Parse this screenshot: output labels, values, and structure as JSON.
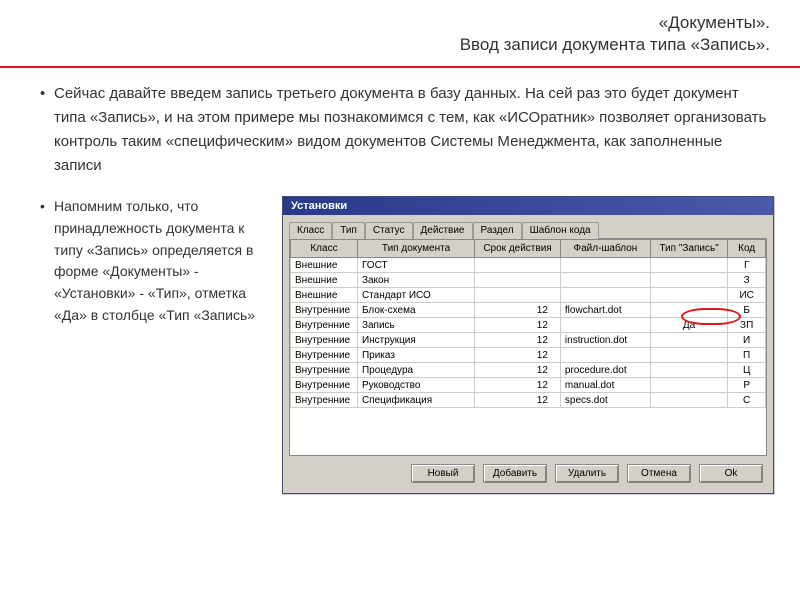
{
  "header": {
    "line1": "«Документы».",
    "line2": "Ввод записи документа типа «Запись»."
  },
  "main_bullet": "Сейчас давайте введем запись третьего документа в базу данных. На сей раз это будет документ типа «Запись», и на этом примере мы познакомимся с тем, как «ИСОратник» позволяет организовать контроль таким «специфическим» видом документов Системы Менеджмента, как заполненные записи",
  "side_bullet": "Напомним только, что принадлежность документа к типу «Запись» определяется в форме «Документы» - «Установки» - «Тип», отметка «Да» в столбце «Тип «Запись»",
  "dialog": {
    "title": "Установки",
    "tabs": [
      "Класс",
      "Тип",
      "Статус",
      "Действие",
      "Раздел",
      "Шаблон кода"
    ],
    "active_tab_index": 1,
    "columns": [
      "Класс",
      "Тип документа",
      "Срок действия",
      "Файл-шаблон",
      "Тип \"Запись\"",
      "Код"
    ],
    "rows": [
      {
        "class": "Внешние",
        "type": "ГОСТ",
        "term": "",
        "file": "",
        "zapis": "",
        "code": "Г"
      },
      {
        "class": "Внешние",
        "type": "Закон",
        "term": "",
        "file": "",
        "zapis": "",
        "code": "З"
      },
      {
        "class": "Внешние",
        "type": "Стандарт ИСО",
        "term": "",
        "file": "",
        "zapis": "",
        "code": "ИС"
      },
      {
        "class": "Внутренние",
        "type": "Блок-схема",
        "term": "12",
        "file": "flowchart.dot",
        "zapis": "",
        "code": "Б"
      },
      {
        "class": "Внутренние",
        "type": "Запись",
        "term": "12",
        "file": "",
        "zapis": "Да",
        "code": "ЗП"
      },
      {
        "class": "Внутренние",
        "type": "Инструкция",
        "term": "12",
        "file": "instruction.dot",
        "zapis": "",
        "code": "И"
      },
      {
        "class": "Внутренние",
        "type": "Приказ",
        "term": "12",
        "file": "",
        "zapis": "",
        "code": "П"
      },
      {
        "class": "Внутренние",
        "type": "Процедура",
        "term": "12",
        "file": "procedure.dot",
        "zapis": "",
        "code": "Ц"
      },
      {
        "class": "Внутренние",
        "type": "Руководство",
        "term": "12",
        "file": "manual.dot",
        "zapis": "",
        "code": "Р"
      },
      {
        "class": "Внутренние",
        "type": "Спецификация",
        "term": "12",
        "file": "specs.dot",
        "zapis": "",
        "code": "С"
      }
    ],
    "buttons": [
      "Новый",
      "Добавить",
      "Удалить",
      "Отмена",
      "Ok"
    ]
  }
}
